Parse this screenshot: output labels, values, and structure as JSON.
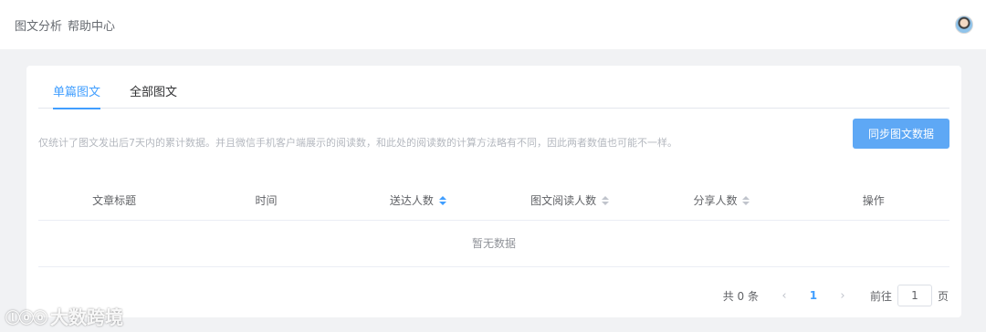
{
  "header": {
    "breadcrumb": [
      "图文分析",
      "帮助中心"
    ]
  },
  "tabs": [
    {
      "label": "单篇图文",
      "active": true
    },
    {
      "label": "全部图文",
      "active": false
    }
  ],
  "notice": "仅统计了图文发出后7天内的累计数据。并且微信手机客户端展示的阅读数，和此处的阅读数的计算方法略有不同，因此两者数值也可能不一样。",
  "sync_button": "同步图文数据",
  "table": {
    "columns": [
      "文章标题",
      "时间",
      "送达人数",
      "图文阅读人数",
      "分享人数",
      "操作"
    ],
    "empty_text": "暂无数据"
  },
  "pagination": {
    "total": "共 0 条",
    "current_page": "1",
    "goto_label": "前往",
    "goto_value": "1",
    "unit": "页"
  },
  "watermark": {
    "logo": "ⓛⓞⓞ",
    "text": "大数跨境"
  },
  "colors": {
    "accent": "#409eff",
    "button": "#5ea8f5",
    "background": "#f1f2f4"
  }
}
